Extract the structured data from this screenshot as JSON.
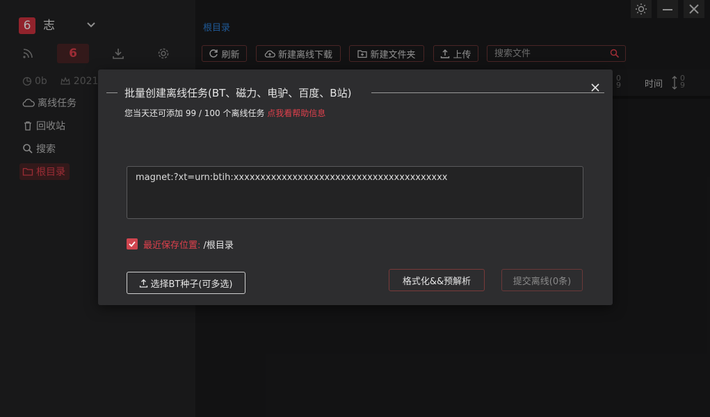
{
  "sidebar": {
    "avatar_text": "6",
    "username": "志",
    "active_tab_text": "6",
    "quota_used": "0b",
    "quota_date": "2021",
    "nav": {
      "offline": "离线任务",
      "recycle": "回收站",
      "search": "搜索",
      "root": "根目录"
    }
  },
  "main": {
    "breadcrumb": "根目录",
    "toolbar": {
      "refresh": "刷新",
      "new_offline": "新建离线下载",
      "new_folder": "新建文件夹",
      "upload": "上传"
    },
    "search_placeholder": "搜索文件",
    "header": {
      "sort_digits_a": "0\n9",
      "time_label": "时间",
      "sort_digits_b": "0\n9"
    }
  },
  "dialog": {
    "title": "批量创建离线任务(BT、磁力、电驴、百度、B站)",
    "subtitle_prefix": "您当天还可添加 99 / 100 个离线任务 ",
    "help_link": "点我看帮助信息",
    "magnet_value": "magnet:?xt=urn:btih:xxxxxxxxxxxxxxxxxxxxxxxxxxxxxxxxxxxxxxxx",
    "save_label": "最近保存位置:",
    "save_path": " /根目录",
    "bt_button": "选择BT种子(可多选)",
    "format_button": "格式化&&预解析",
    "submit_button": "提交离线(0条)"
  },
  "colors": {
    "accent": "#e0404c",
    "link": "#2d7fd6",
    "background": "#1b1b1c",
    "dialog_bg": "#2d2d2f"
  }
}
